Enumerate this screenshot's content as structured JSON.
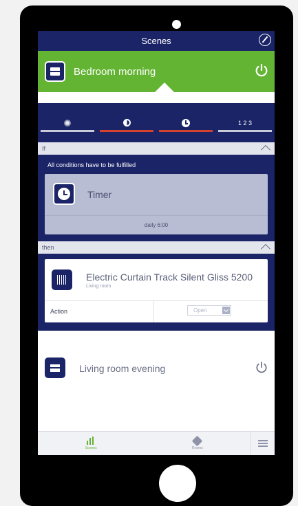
{
  "header": {
    "title": "Scenes"
  },
  "current_scene": {
    "name": "Bedroom morning"
  },
  "tabs": [
    {
      "icon": "dot-icon",
      "active": false
    },
    {
      "icon": "half-moon-icon",
      "active": true
    },
    {
      "icon": "clock-icon",
      "active": true
    },
    {
      "icon": "steps-icon",
      "label": "1 2 3",
      "active": false
    }
  ],
  "if_section": {
    "label": "If",
    "conditions_text": "All conditions have to be fulfilled",
    "timer": {
      "label": "Timer",
      "schedule": "daily 6:00"
    }
  },
  "then_section": {
    "label": "then",
    "device": {
      "name": "Electric Curtain Track Silent Gliss 5200",
      "room": "Living room",
      "action_label": "Action",
      "action_value": "Open"
    }
  },
  "other_scene": {
    "name": "Living room evening"
  },
  "bottom_nav": {
    "scenes": "Scenes",
    "rooms": "Rooms"
  },
  "colors": {
    "navy": "#1b2467",
    "green": "#63b432",
    "accent_red": "#d6412d"
  }
}
